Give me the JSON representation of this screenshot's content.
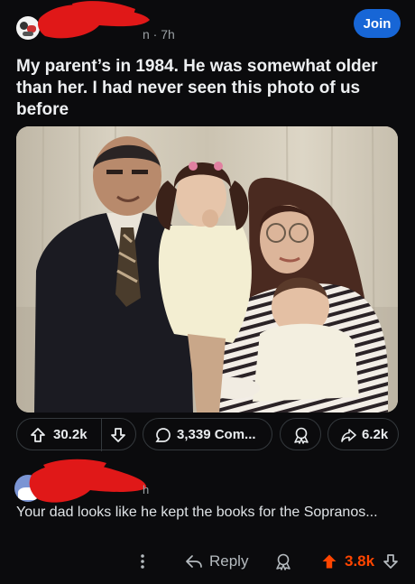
{
  "post": {
    "meta_suffix": "n · 7h",
    "join_label": "Join",
    "title": "My parent’s in 1984.  He was somewhat older than her.  I had never seen this photo of us before",
    "upvotes": "30.2k",
    "comments": "3,339 Com...",
    "shares": "6.2k"
  },
  "comment": {
    "time_suffix": "h",
    "body": "Your dad looks like he kept the books for the Sopranos...",
    "reply_label": "Reply",
    "votes": "3.8k"
  },
  "colors": {
    "background": "#0b0b0d",
    "join": "#1766d6",
    "redaction": "#e01818",
    "upvote_active": "#ff4500"
  }
}
